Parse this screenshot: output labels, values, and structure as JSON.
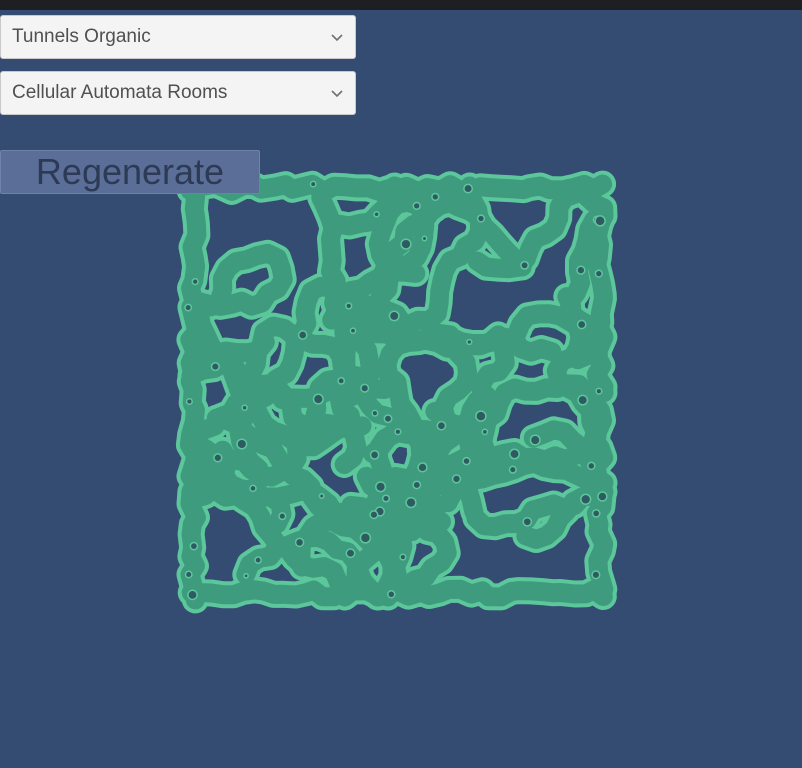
{
  "controls": {
    "generator_dropdown": {
      "selected": "Tunnels Organic"
    },
    "rooms_dropdown": {
      "selected": "Cellular Automata Rooms"
    },
    "regenerate_label": "Regenerate"
  },
  "icons": {
    "dropdown_arrow": "chevron-down-icon"
  },
  "colors": {
    "background": "#344b72",
    "floor": "#3f9b7e",
    "floor_edge": "#5cc79b",
    "top_bar": "#1f1f23"
  }
}
